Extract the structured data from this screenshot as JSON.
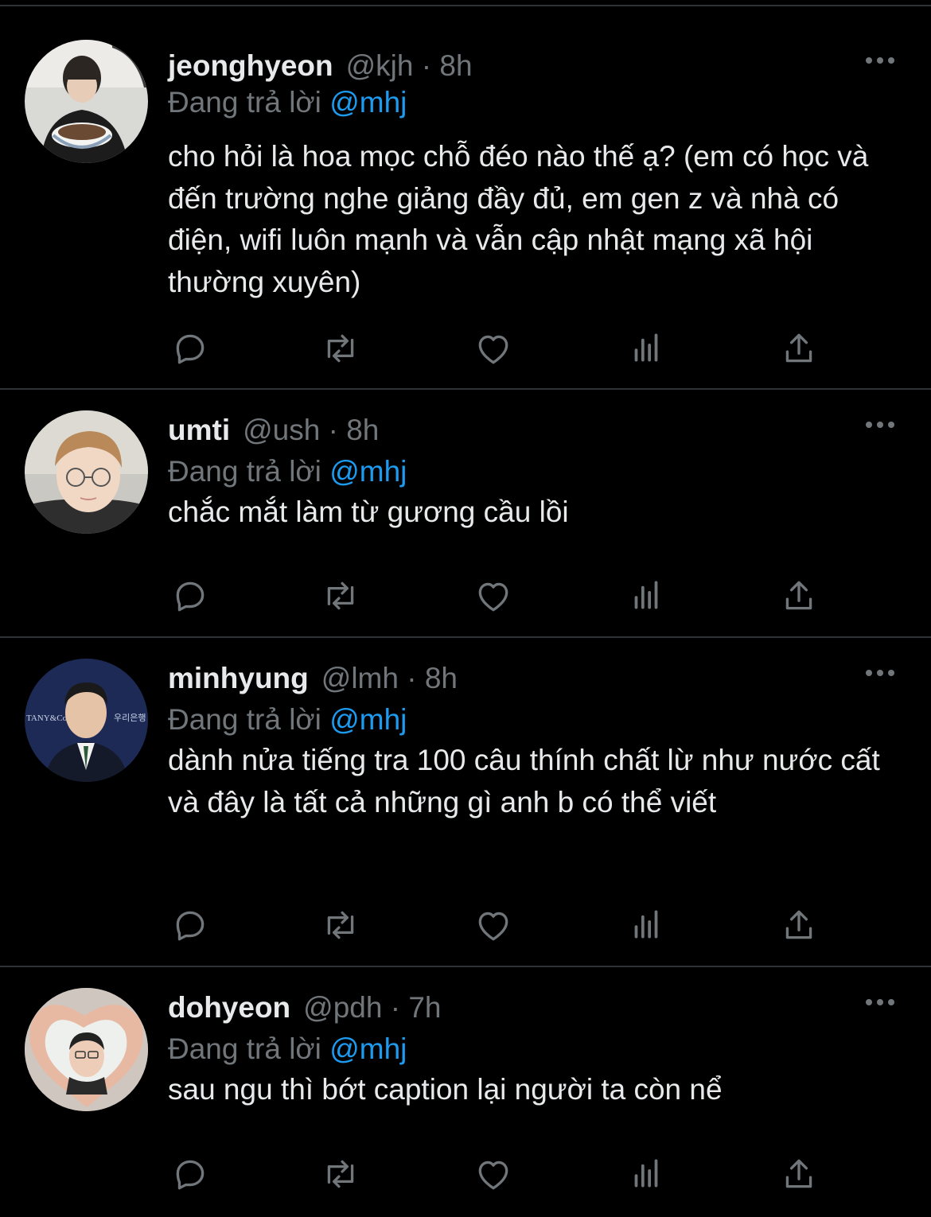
{
  "theme": {
    "background": "#000000",
    "text": "#e7e9ea",
    "secondary": "#71767b",
    "accent": "#1d9bf0",
    "divider": "#2f3336"
  },
  "tweets": [
    {
      "name": "jeonghyeon",
      "meta": "@kjh · 8h",
      "reply_prefix": "Đang trả lời",
      "reply_handle": "@mhj",
      "text": "cho hỏi là hoa mọc chỗ đéo nào thế ạ? (em có học và đến trường nghe giảng đầy đủ, em gen z và nhà có điện, wifi luôn mạnh và vẫn cập nhật mạng xã hội thường xuyên)",
      "avatar": "avatar-photo-boy-eating"
    },
    {
      "name": "umti",
      "meta": "@ush · 8h",
      "reply_prefix": "Đang trả lời",
      "reply_handle": "@mhj",
      "text": "chắc mắt làm từ gương cầu lồi",
      "avatar": "avatar-photo-glasses"
    },
    {
      "name": "minhyung",
      "meta": "@lmh · 8h",
      "reply_prefix": "Đang trả lời",
      "reply_handle": "@mhj",
      "text": "dành nửa tiếng tra 100 câu thính chất lừ như nước cất và đây là tất cả những gì anh b có thể viết",
      "avatar": "avatar-photo-suit",
      "avatar_text_left": "TANY&Co",
      "avatar_text_right": "우리은행"
    },
    {
      "name": "dohyeon",
      "meta": "@pdh · 7h",
      "reply_prefix": "Đang trả lời",
      "reply_handle": "@mhj",
      "text": "sau ngu thì bớt caption lại người ta còn nể",
      "avatar": "avatar-photo-heart-hands"
    }
  ],
  "icons": {
    "more": "more-dots-icon",
    "reply": "reply-icon",
    "retweet": "retweet-icon",
    "like": "like-icon",
    "views": "views-icon",
    "share": "share-icon"
  }
}
